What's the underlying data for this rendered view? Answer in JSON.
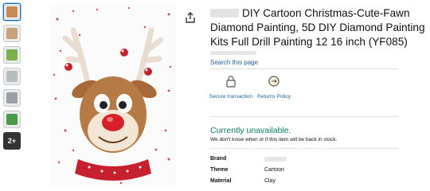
{
  "title_text": "DIY Cartoon Christmas-Cute-Fawn Diamond Painting, 5D DIY Diamond Painting Kits Full Drill Painting 12 16 inch (YF085)",
  "search_link": "Search this page",
  "features": [
    {
      "label": "Secure transaction",
      "icon": "lock-icon"
    },
    {
      "label": "Returns Policy",
      "icon": "returns-icon"
    }
  ],
  "availability": "Currently unavailable.",
  "availability_note": "We don't know when or if this item will be back in stock.",
  "specs": [
    {
      "key": "Brand",
      "value": ""
    },
    {
      "key": "Theme",
      "value": "Cartoon"
    },
    {
      "key": "Material",
      "value": "Clay"
    }
  ],
  "thumbnails_more": "2+",
  "colors": {
    "link": "#2162a1",
    "available": "#067d62",
    "nose": "#d8202a"
  }
}
